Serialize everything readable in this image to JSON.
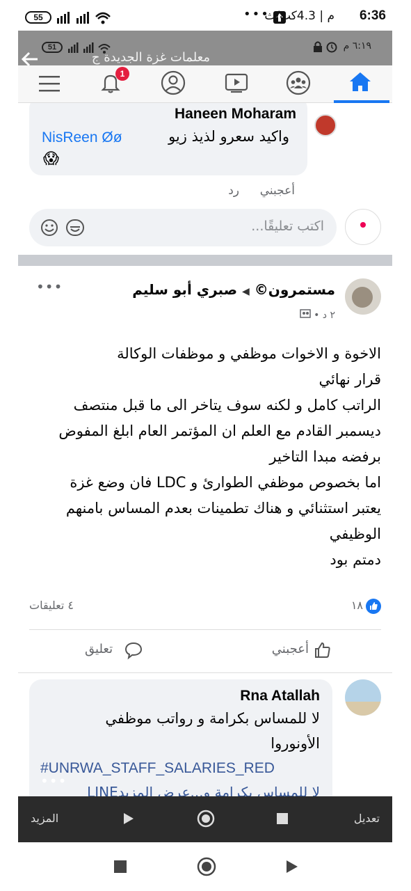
{
  "outer_status": {
    "time": "6:36",
    "network": "م | 4.3كب/ث",
    "battery": "55",
    "dots": "•••"
  },
  "inner_status": {
    "time": "٦:١٩ م",
    "battery": "51",
    "group_title": "معلمات غزة الجديدة ج"
  },
  "nav": {
    "notifications_count": "1",
    "icons": [
      "menu-icon",
      "bell-icon",
      "profile-icon",
      "video-icon",
      "groups-icon",
      "home-icon"
    ],
    "accent": "#1877f2"
  },
  "comment1": {
    "author": "Haneen Moharam",
    "text": "واكيد سعرو لذيذ زيو",
    "mention": "NisReen Øø",
    "emoji": "😱",
    "like": "أعجبني",
    "reply": "رد"
  },
  "comment_input": {
    "placeholder": "اكتب تعليقًا..."
  },
  "post": {
    "author": "صبري أبو سليم",
    "group": "مستمرون©",
    "meta": "٢ د •",
    "lines": [
      "الاخوة و الاخوات موظفي و موظفات الوكالة",
      "قرار نهائي",
      "الراتب كامل و لكنه سوف يتاخر الى ما قبل منتصف",
      "ديسمبر القادم مع العلم ان المؤتمر العام ابلغ المفوض",
      "برفضه مبدا التاخير",
      "اما بخصوص موظفي الطوارئ و LDC فان وضع غزة",
      "يعتبر استثنائي و هناك تطمينات بعدم المساس بامنهم",
      "الوظيفي",
      "دمتم بود"
    ],
    "likes_count": "١٨",
    "comments_count": "٤ تعليقات",
    "like_label": "أعجبني",
    "comment_label": "تعليق"
  },
  "comment2": {
    "author": "Rna Atallah",
    "line1": "لا للمساس بكرامة و رواتب موظفي",
    "line2": "الأونوروا",
    "hashtag": "#UNRWA_STAFF_SALARIES_RED",
    "line3": "لا للمساس بكرامة و...عرض المزيدLINE"
  },
  "shot_bottom": {
    "edit": "تعديل",
    "more": "المزيد"
  }
}
